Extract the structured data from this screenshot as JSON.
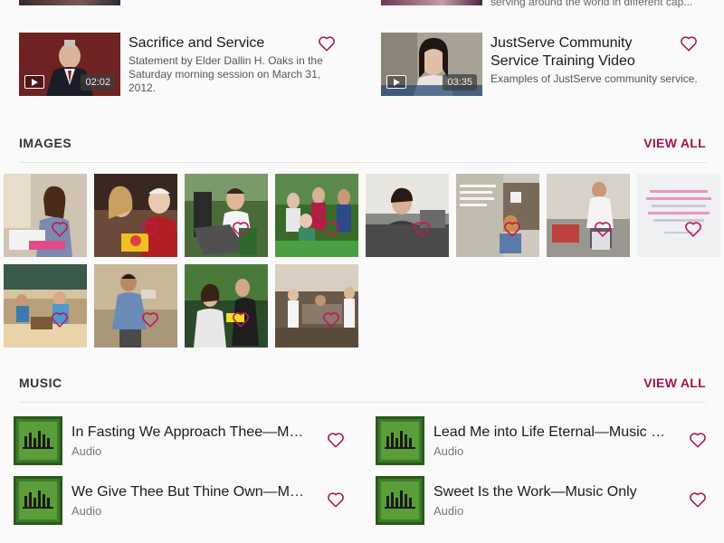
{
  "top_row": {
    "right_snippet": "serving around the world in different cap..."
  },
  "videos": [
    {
      "title": "Sacrifice and Service",
      "description": "Statement by Elder Dallin H. Oaks in the Saturday morning session on March 31, 2012.",
      "duration": "02:02",
      "icon": "play-icon"
    },
    {
      "title": "JustServe Community Service Training Video",
      "description": "Examples of JustServe community service.",
      "duration": "03:35",
      "icon": "play-icon"
    }
  ],
  "images_section": {
    "title": "IMAGES",
    "view_all": "VIEW ALL",
    "tiles": [
      "sewing-woman",
      "cooking-couple",
      "boys-service",
      "garden-group",
      "young-man-car",
      "quote-girl",
      "teen-volunteer",
      "peace-quote",
      "construction-team",
      "man-carrying",
      "girl-service",
      "group-outdoors"
    ]
  },
  "music_section": {
    "title": "MUSIC",
    "view_all": "VIEW ALL",
    "items": [
      {
        "title": "In Fasting We Approach Thee—M…",
        "type": "Audio"
      },
      {
        "title": "Lead Me into Life Eternal—Music …",
        "type": "Audio"
      },
      {
        "title": "We Give Thee But Thine Own—M…",
        "type": "Audio"
      },
      {
        "title": "Sweet Is the Work—Music Only",
        "type": "Audio"
      }
    ]
  },
  "colors": {
    "accent": "#a3104e",
    "music_cover": "#3d7a2a",
    "background": "#fafafa"
  }
}
